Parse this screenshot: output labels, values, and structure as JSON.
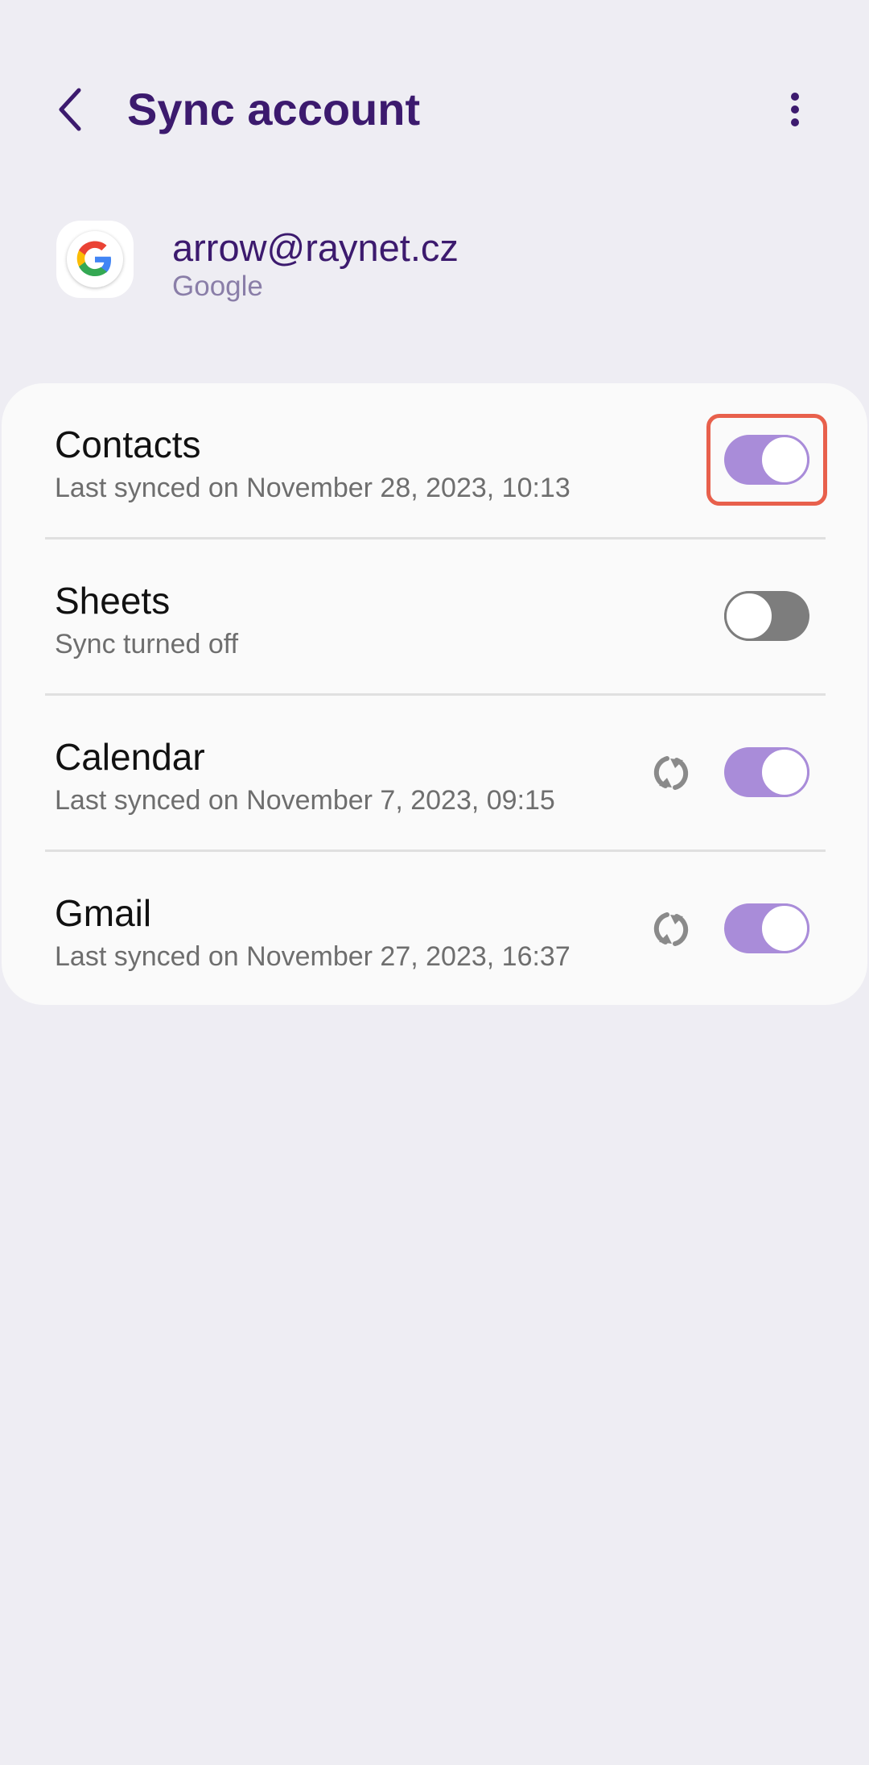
{
  "header": {
    "title": "Sync account",
    "back_icon": "chevron-left-icon",
    "more_icon": "more-vertical-icon"
  },
  "account": {
    "email": "arrow@raynet.cz",
    "provider": "Google",
    "logo_icon": "google-logo-icon"
  },
  "colors": {
    "title": "#3c1a6e",
    "toggle_on": "#a98cd9",
    "toggle_off": "#7d7d7d",
    "highlight": "#e8604c"
  },
  "sync_items": [
    {
      "title": "Contacts",
      "subtitle": "Last synced on November 28, 2023, 10:13",
      "enabled": true,
      "highlighted": true
    },
    {
      "title": "Sheets",
      "subtitle": "Sync turned off",
      "enabled": false
    },
    {
      "title": "Calendar",
      "subtitle": "Last synced on November 7, 2023, 09:15",
      "enabled": true,
      "sync_icon": "sync-icon"
    },
    {
      "title": "Gmail",
      "subtitle": "Last synced on November 27, 2023, 16:37",
      "enabled": true,
      "sync_icon": "sync-icon"
    }
  ]
}
